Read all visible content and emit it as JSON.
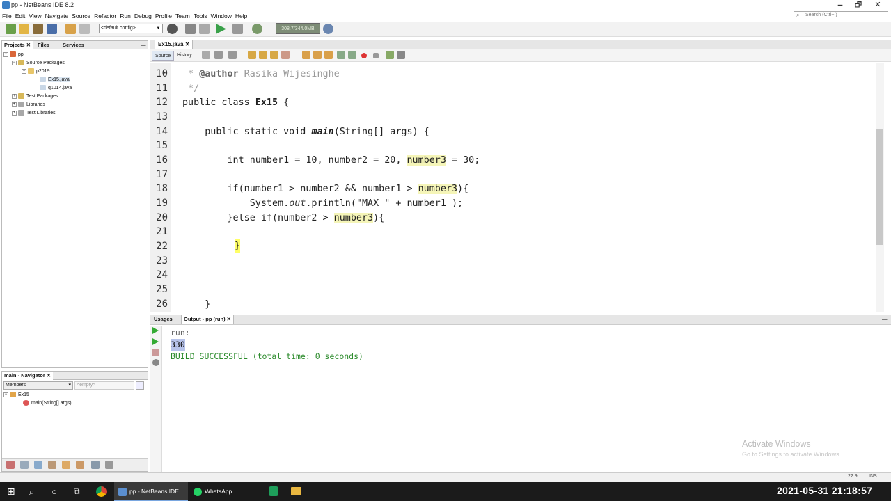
{
  "window": {
    "title": "pp - NetBeans IDE 8.2",
    "minimize": "🗕",
    "maximize": "🗗",
    "close": "✕"
  },
  "menu": [
    "File",
    "Edit",
    "View",
    "Navigate",
    "Source",
    "Refactor",
    "Run",
    "Debug",
    "Profile",
    "Team",
    "Tools",
    "Window",
    "Help"
  ],
  "search": {
    "placeholder": "Search (Ctrl+I)"
  },
  "toolbar": {
    "config": "<default config>",
    "memory": "308.7/344.0MB"
  },
  "projects_panel": {
    "tabs": [
      "Projects",
      "Files",
      "Services"
    ],
    "tree": [
      {
        "label": "pp",
        "depth": 0
      },
      {
        "label": "Source Packages",
        "depth": 1
      },
      {
        "label": "p2019",
        "depth": 2
      },
      {
        "label": "Ex15.java",
        "depth": 3
      },
      {
        "label": "q1014.java",
        "depth": 3
      },
      {
        "label": "Test Packages",
        "depth": 1
      },
      {
        "label": "Libraries",
        "depth": 1
      },
      {
        "label": "Test Libraries",
        "depth": 1
      }
    ]
  },
  "navigator": {
    "title": "main - Navigator",
    "members_label": "Members",
    "filter_value": "<empty>",
    "tree": [
      {
        "label": "Ex15"
      },
      {
        "label": "main(String[] args)"
      }
    ]
  },
  "editor": {
    "tab": "Ex15.java",
    "source_tab": "Source",
    "history_tab": "History",
    "line_numbers": [
      "10",
      "11",
      "12",
      "13",
      "14",
      "15",
      "16",
      "17",
      "18",
      "19",
      "20",
      "21",
      "22",
      "23",
      "24",
      "25",
      "26"
    ],
    "code": {
      "l10_a": " * ",
      "l10_b": "@author",
      "l10_c": " Rasika Wijesinghe",
      "l11": " */",
      "l12_a": "public class ",
      "l12_b": "Ex15",
      "l12_c": " {",
      "l14_a": "    public static void ",
      "l14_b": "main",
      "l14_c": "(String[] args) {",
      "l16_a": "        int number1 = 10, number2 = 20, ",
      "l16_b": "number3",
      "l16_c": " = 30;",
      "l18_a": "        if(number1 > number2 && number1 > ",
      "l18_b": "number3",
      "l18_c": "){",
      "l19_a": "            System.",
      "l19_b": "out",
      "l19_c": ".println(\"MAX \" + number1 );",
      "l20_a": "        }else if(number2 > ",
      "l20_b": "number3",
      "l20_c": "){",
      "l22": "}",
      "l26": "    }"
    }
  },
  "output": {
    "tabs": [
      "Usages",
      "Output - pp (run)"
    ],
    "lines": [
      "run:",
      "330",
      "BUILD SUCCESSFUL (total time: 0 seconds)"
    ]
  },
  "watermark": {
    "line1": "Activate Windows",
    "line2": "Go to Settings to activate Windows."
  },
  "status": {
    "position": "22:9",
    "mode": "INS"
  },
  "taskbar": {
    "netbeans": "pp - NetBeans IDE ...",
    "whatsapp": "WhatsApp",
    "clock": "2021-05-31  21:18:57"
  }
}
